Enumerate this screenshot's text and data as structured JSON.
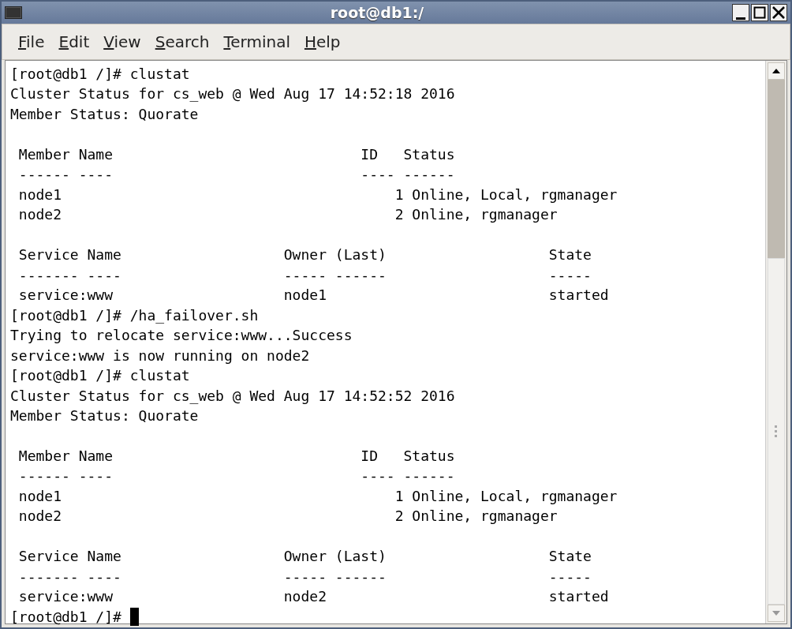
{
  "window": {
    "title": "root@db1:/"
  },
  "menu": [
    {
      "label": "File"
    },
    {
      "label": "Edit"
    },
    {
      "label": "View"
    },
    {
      "label": "Search"
    },
    {
      "label": "Terminal"
    },
    {
      "label": "Help"
    }
  ],
  "terminal": {
    "lines": [
      {
        "kind": "text",
        "text": "[root@db1 /]# clustat"
      },
      {
        "kind": "text",
        "text": "Cluster Status for cs_web @ Wed Aug 17 14:52:18 2016"
      },
      {
        "kind": "text",
        "text": "Member Status: Quorate"
      },
      {
        "kind": "blank"
      },
      {
        "kind": "text",
        "text": " Member Name                             ID   Status"
      },
      {
        "kind": "text",
        "text": " ------ ----                             ---- ------"
      },
      {
        "kind": "text",
        "text": " node1                                       1 Online, Local, rgmanager"
      },
      {
        "kind": "text",
        "text": " node2                                       2 Online, rgmanager"
      },
      {
        "kind": "blank"
      },
      {
        "kind": "text",
        "text": " Service Name                   Owner (Last)                   State"
      },
      {
        "kind": "text",
        "text": " ------- ----                   ----- ------                   -----"
      },
      {
        "kind": "text",
        "text": " service:www                    node1                          started"
      },
      {
        "kind": "text",
        "text": "[root@db1 /]# /ha_failover.sh"
      },
      {
        "kind": "text",
        "text": "Trying to relocate service:www...Success"
      },
      {
        "kind": "text",
        "text": "service:www is now running on node2"
      },
      {
        "kind": "text",
        "text": "[root@db1 /]# clustat"
      },
      {
        "kind": "text",
        "text": "Cluster Status for cs_web @ Wed Aug 17 14:52:52 2016"
      },
      {
        "kind": "text",
        "text": "Member Status: Quorate"
      },
      {
        "kind": "blank"
      },
      {
        "kind": "text",
        "text": " Member Name                             ID   Status"
      },
      {
        "kind": "text",
        "text": " ------ ----                             ---- ------"
      },
      {
        "kind": "text",
        "text": " node1                                       1 Online, Local, rgmanager"
      },
      {
        "kind": "text",
        "text": " node2                                       2 Online, rgmanager"
      },
      {
        "kind": "blank"
      },
      {
        "kind": "text",
        "text": " Service Name                   Owner (Last)                   State"
      },
      {
        "kind": "text",
        "text": " ------- ----                   ----- ------                   -----"
      },
      {
        "kind": "text",
        "text": " service:www                    node2                          started"
      },
      {
        "kind": "prompt",
        "text": "[root@db1 /]# ",
        "cursor": true
      }
    ]
  }
}
